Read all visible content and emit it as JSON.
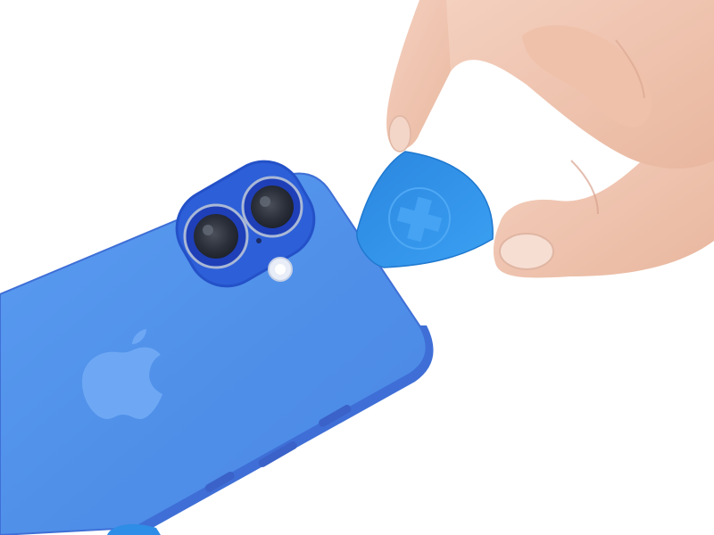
{
  "scene": {
    "description_visible_text": "",
    "colors": {
      "background": "#ffffff",
      "phone_body": "#4f8fe8",
      "phone_edge": "#3f6fd6",
      "camera_bump": "#2d5fd8",
      "camera_ring": "#1f3fb8",
      "lens_glass": "#2a2f3a",
      "opening_pick": "#2e8de6",
      "skin": "#f1c6b0",
      "nail": "#f6ded3"
    },
    "icons": {
      "phone": "smartphone-back-icon",
      "logo": "apple-logo-icon",
      "pick": "opening-pick-icon",
      "hand": "hand-icon"
    }
  }
}
